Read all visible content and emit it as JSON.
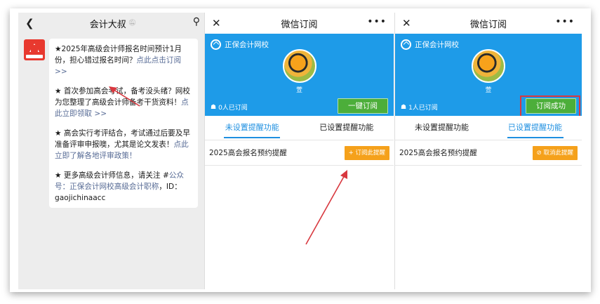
{
  "chat": {
    "title": "会计大叔",
    "back_icon": "chevron-left-icon",
    "mute_icon": "bell-off-icon",
    "profile_icon": "person-icon",
    "messages": [
      {
        "text": "★2025年高级会计师报名时间预计1月份，担心错过报名时间？",
        "link": "点此点击订阅 >>"
      },
      {
        "text": "★ 首次参加高会考试，备考没头绪？网校为您整理了高级会计师备考干货资料！",
        "link": "点此立即领取 >>"
      },
      {
        "text": "★ 高会实行考评结合，考试通过后要及早准备评审申报噢，尤其是论文发表！",
        "link": "点此立即了解各地评审政策！"
      },
      {
        "text": "★ 更多高级会计师信息，请关注 #",
        "link": "公众号：正保会计网校高级会计职称",
        "tail": "，ID：gaojichinaacc"
      }
    ]
  },
  "subscribe_before": {
    "title": "微信订阅",
    "brand": "正保会计网校",
    "name": "萱",
    "count": "0人已订阅",
    "button": "一键订阅",
    "tabs": [
      "未设置提醒功能",
      "已设置提醒功能"
    ],
    "active_tab": 0,
    "item": "2025高会报名预约提醒",
    "item_button": "+ 订阅此提醒"
  },
  "subscribe_after": {
    "title": "微信订阅",
    "brand": "正保会计网校",
    "name": "萱",
    "count": "1人已订阅",
    "button": "订阅成功",
    "tabs": [
      "未设置提醒功能",
      "已设置提醒功能"
    ],
    "active_tab": 1,
    "item": "2025高会报名预约提醒",
    "item_button": "⊘ 取消此提醒"
  },
  "colors": {
    "accent_blue": "#1e9be8",
    "green": "#4cae3a",
    "orange": "#f5a11b",
    "annotation_red": "#d8383f",
    "link": "#576b95"
  }
}
